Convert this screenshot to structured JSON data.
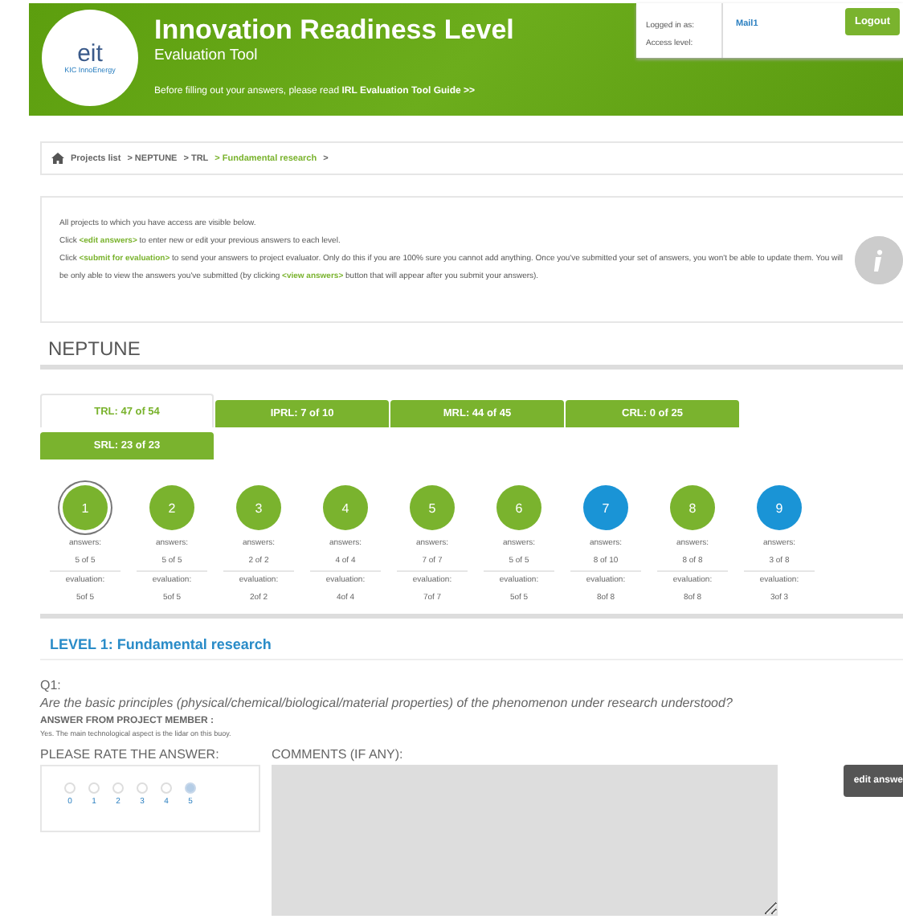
{
  "header": {
    "logo": {
      "mark": "eit",
      "name": "KIC InnoEnergy"
    },
    "title": "Innovation Readiness Level",
    "subtitle": "Evaluation Tool",
    "notice": [
      {
        "text": "Before filling out your answers, please read ",
        "link": false
      },
      {
        "text": "IRL Evaluation Tool Guide >>",
        "link": true
      }
    ],
    "user": {
      "logged_in_label": "Logged in as:",
      "access_label": "Access level:",
      "user_name": "Mail1"
    },
    "logout": "Logout"
  },
  "breadcrumb": [
    {
      "label": "Projects list",
      "current": false
    },
    {
      "label": "> NEPTUNE",
      "current": false
    },
    {
      "label": "> TRL",
      "current": false
    },
    {
      "label": "> Fundamental research",
      "current": true
    },
    {
      "label": ">",
      "current": false
    }
  ],
  "info": [
    [
      {
        "text": "All projects to which you have access are visible below.",
        "link": false
      }
    ],
    [
      {
        "text": "Click ",
        "link": false
      },
      {
        "text": "<edit answers>",
        "link": true
      },
      {
        "text": " to enter new or edit your previous answers to each level.",
        "link": false
      }
    ],
    [
      {
        "text": "Click ",
        "link": false
      },
      {
        "text": "<submit for evaluation>",
        "link": true
      },
      {
        "text": " to send your answers to project evaluator. Only do this if you are 100% sure you cannot add anything. Once you've submitted your set of answers, you won't be able to update them. You will be only able to view the answers you've submitted (by clicking ",
        "link": false
      },
      {
        "text": "<view answers>",
        "link": true
      },
      {
        "text": " button that will appear after you submit your answers).",
        "link": false
      }
    ]
  ],
  "project": "NEPTUNE",
  "tabs": [
    {
      "label": "TRL: 47 of 54",
      "selected": true
    },
    {
      "label": "IPRL: 7 of 10",
      "selected": false
    },
    {
      "label": "MRL: 44 of 45",
      "selected": false
    },
    {
      "label": "CRL: 0 of 25",
      "selected": false
    },
    {
      "label": "SRL: 23 of 23",
      "selected": false
    }
  ],
  "levels": [
    {
      "number": "1",
      "color": "#7ab32e",
      "selected": true,
      "answers_label": "answers:",
      "answers": "5 of 5",
      "evaluation_label": "evaluation:",
      "evaluation": "5of 5"
    },
    {
      "number": "2",
      "color": "#7ab32e",
      "selected": false,
      "answers_label": "answers:",
      "answers": "5 of 5",
      "evaluation_label": "evaluation:",
      "evaluation": "5of 5"
    },
    {
      "number": "3",
      "color": "#7ab32e",
      "selected": false,
      "answers_label": "answers:",
      "answers": "2 of 2",
      "evaluation_label": "evaluation:",
      "evaluation": "2of 2"
    },
    {
      "number": "4",
      "color": "#7ab32e",
      "selected": false,
      "answers_label": "answers:",
      "answers": "4 of 4",
      "evaluation_label": "evaluation:",
      "evaluation": "4of 4"
    },
    {
      "number": "5",
      "color": "#7ab32e",
      "selected": false,
      "answers_label": "answers:",
      "answers": "7 of 7",
      "evaluation_label": "evaluation:",
      "evaluation": "7of 7"
    },
    {
      "number": "6",
      "color": "#7ab32e",
      "selected": false,
      "answers_label": "answers:",
      "answers": "5 of 5",
      "evaluation_label": "evaluation:",
      "evaluation": "5of 5"
    },
    {
      "number": "7",
      "color": "#1a94d6",
      "selected": false,
      "answers_label": "answers:",
      "answers": "8 of 10",
      "evaluation_label": "evaluation:",
      "evaluation": "8of 8"
    },
    {
      "number": "8",
      "color": "#7ab32e",
      "selected": false,
      "answers_label": "answers:",
      "answers": "8 of 8",
      "evaluation_label": "evaluation:",
      "evaluation": "8of 8"
    },
    {
      "number": "9",
      "color": "#1a94d6",
      "selected": false,
      "answers_label": "answers:",
      "answers": "3 of 8",
      "evaluation_label": "evaluation:",
      "evaluation": "3of 3"
    }
  ],
  "level_title": "LEVEL 1: Fundamental research",
  "question": {
    "number": "Q1:",
    "text": "Are the basic principles (physical/chemical/biological/material properties) of the phenomenon under research understood?",
    "answer_label": "ANSWER FROM PROJECT MEMBER :",
    "answer": "Yes. The main technological aspect is the lidar on this buoy.",
    "rate_label": "PLEASE RATE THE ANSWER:",
    "comments_label": "COMMENTS (IF ANY):",
    "ratings": [
      {
        "label": "0",
        "selected": false
      },
      {
        "label": "1",
        "selected": false
      },
      {
        "label": "2",
        "selected": false
      },
      {
        "label": "3",
        "selected": false
      },
      {
        "label": "4",
        "selected": false
      },
      {
        "label": "5",
        "selected": true
      }
    ],
    "edit_button": "edit answe"
  }
}
